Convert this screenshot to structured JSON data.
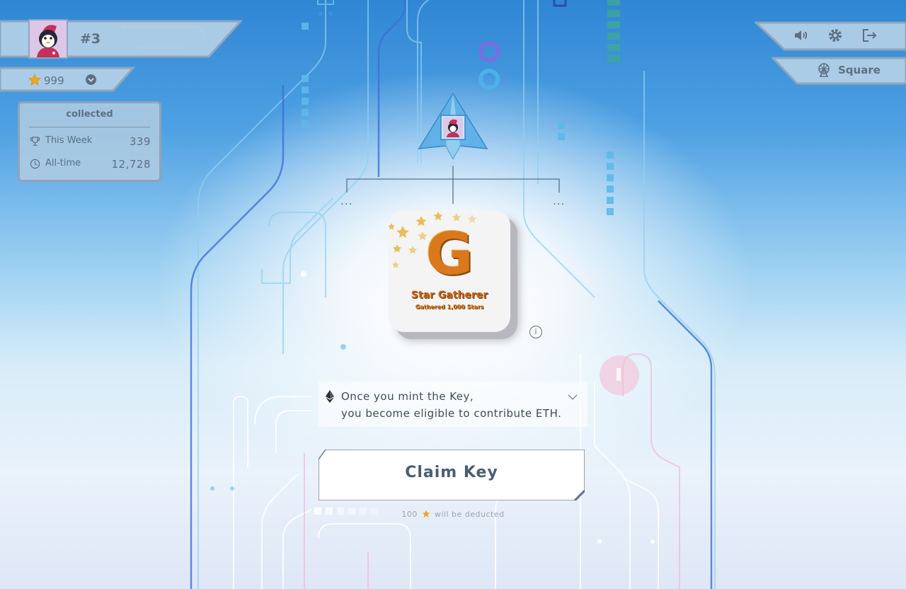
{
  "player": {
    "rank": "#3",
    "stars": "999"
  },
  "collected": {
    "title": "collected",
    "this_week_label": "This Week",
    "this_week_value": "339",
    "all_time_label": "All-time",
    "all_time_value": "12,728"
  },
  "controls": {
    "square_label": "Square"
  },
  "branches": {
    "left": "...",
    "right": "..."
  },
  "badge": {
    "letter": "G",
    "title": "Star Gatherer",
    "subtitle": "Gathered 1,000 Stars",
    "info": "i"
  },
  "notice": {
    "line1": "Once you mint the Key,",
    "line2": "you become eligible to contribute ETH."
  },
  "claim": {
    "label": "Claim Key",
    "cost": "100",
    "deduct_text": "will be deducted"
  },
  "icons": [
    "avatar-penguin",
    "star-icon",
    "chevron-down-icon",
    "trophy-icon",
    "clock-icon",
    "speaker-icon",
    "gear-icon",
    "logout-icon",
    "ferris-wheel-icon",
    "rocket-icon",
    "ethereum-icon",
    "info-icon"
  ],
  "colors": {
    "accent_text": "#5d6f84",
    "badge_orange": "#d9781c",
    "star_gold": "#f2a51a",
    "ethereum": "#2b2b33"
  }
}
